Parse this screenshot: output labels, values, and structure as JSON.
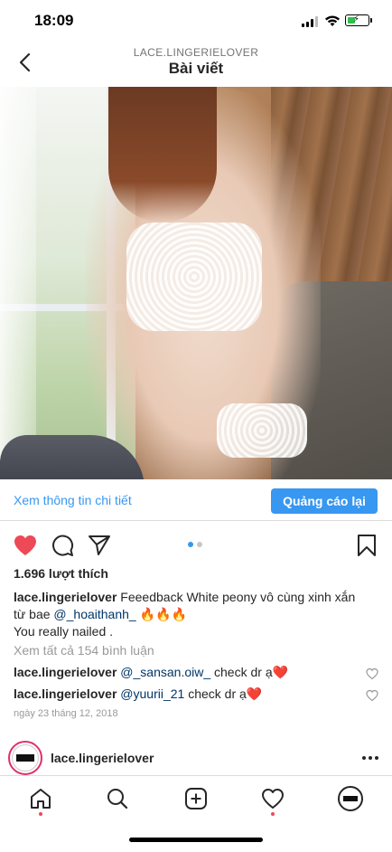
{
  "status_bar": {
    "time": "18:09"
  },
  "header": {
    "account": "LACE.LINGERIELOVER",
    "title": "Bài viết"
  },
  "post": {
    "cta_link": "Xem thông tin chi tiết",
    "cta_button": "Quảng cáo lại",
    "likes": "1.696 lượt thích",
    "caption": {
      "user": "lace.lingerielover",
      "text_1": " Feeedback White peony vô cùng xinh xắn từ bae ",
      "mention": "@_hoaithanh_",
      "emoji": " 🔥🔥🔥",
      "line_2": "You really nailed ."
    },
    "view_all_comments": "Xem tất cả 154 bình luận",
    "comments": [
      {
        "user": "lace.lingerielover",
        "mention": "@_sansan.oiw_",
        "text": " check dr ạ❤️"
      },
      {
        "user": "lace.lingerielover",
        "mention": "@yuurii_21",
        "text": " check dr ạ❤️"
      }
    ],
    "date": "ngày 23 tháng 12, 2018",
    "carousel_index": 1,
    "carousel_total": 2,
    "liked": true
  },
  "next_post": {
    "user": "lace.lingerielover"
  },
  "tab_bar": {
    "items": [
      "home-icon",
      "search-icon",
      "new-post-icon",
      "activity-icon",
      "profile-avatar"
    ]
  },
  "colors": {
    "accent": "#3897f0",
    "like_red": "#ed4956",
    "text": "#262626",
    "muted": "#999999"
  }
}
